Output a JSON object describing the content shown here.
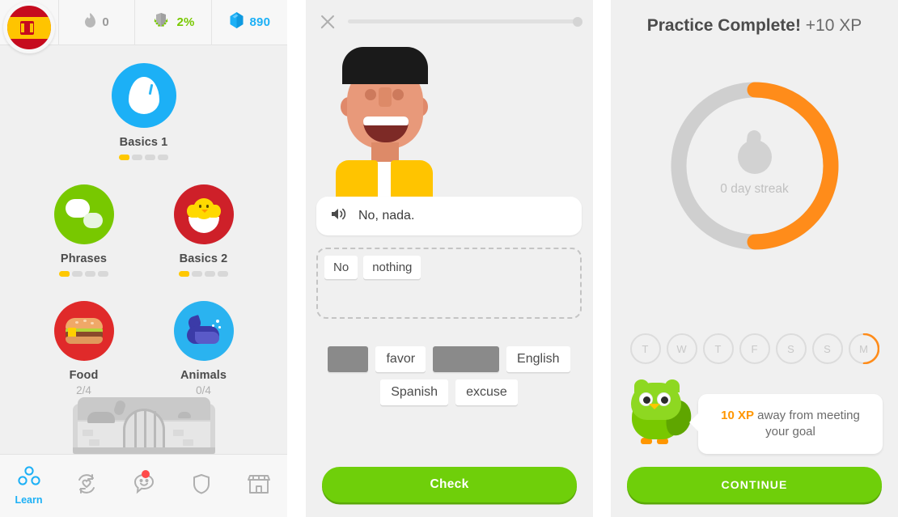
{
  "home": {
    "flag": {
      "name": "spanish-flag",
      "label": "Spanish"
    },
    "stats": [
      {
        "icon": "streak-flame-icon",
        "value": "0",
        "kind": "streak"
      },
      {
        "icon": "shield-laurel-icon",
        "value": "2%",
        "kind": "shield"
      },
      {
        "icon": "gem-icon",
        "value": "890",
        "kind": "gems"
      }
    ],
    "skills": [
      {
        "name": "Basics 1",
        "icon": "egg-icon",
        "color": "#1cb0f6",
        "fraction": "",
        "bars": 5,
        "filled": 1
      },
      {
        "name": "Phrases",
        "icon": "speech-bubbles-icon",
        "color": "#78c800",
        "fraction": "",
        "bars": 5,
        "filled": 1
      },
      {
        "name": "Basics 2",
        "icon": "chick-icon",
        "color": "#ce2029",
        "fraction": "",
        "bars": 5,
        "filled": 1
      },
      {
        "name": "Food",
        "icon": "burger-icon",
        "color": "#e02a2a",
        "fraction": "2/4",
        "bars": 0,
        "filled": 0
      },
      {
        "name": "Animals",
        "icon": "whale-icon",
        "color": "#2ab3f0",
        "fraction": "0/4",
        "bars": 0,
        "filled": 0
      }
    ],
    "checkpoint": {
      "name": "locked-checkpoint",
      "locked": true
    },
    "nav": [
      {
        "label": "Learn",
        "icon": "learn-dots-icon",
        "active": true,
        "badge": false
      },
      {
        "label": "",
        "icon": "practice-refresh-icon",
        "active": false,
        "badge": false
      },
      {
        "label": "",
        "icon": "chat-smiley-icon",
        "active": false,
        "badge": true
      },
      {
        "label": "",
        "icon": "shield-icon",
        "active": false,
        "badge": false
      },
      {
        "label": "",
        "icon": "shop-icon",
        "active": false,
        "badge": false
      }
    ]
  },
  "lesson": {
    "close_icon": "close-x-icon",
    "progress_percent": 0,
    "character": "illustration-man-yellow-jacket",
    "prompt": {
      "speaker_icon": "speaker-icon",
      "text": "No, nada."
    },
    "answer_tiles": [
      "No",
      "nothing"
    ],
    "word_bank": [
      {
        "text": "",
        "used": true
      },
      {
        "text": "favor",
        "used": false
      },
      {
        "text": "",
        "used": true
      },
      {
        "text": "English",
        "used": false
      },
      {
        "text": "Spanish",
        "used": false
      },
      {
        "text": "excuse",
        "used": false
      }
    ],
    "check_button": "Check"
  },
  "complete": {
    "title_bold": "Practice Complete!",
    "title_light": " +10 XP",
    "ring": {
      "label": "0 day streak",
      "percent": 50,
      "track_color": "#cfcfcf",
      "fill_color": "#ff8c1a",
      "flame_icon": "streak-flame-icon"
    },
    "days": [
      {
        "letter": "T",
        "progress": 0
      },
      {
        "letter": "W",
        "progress": 0
      },
      {
        "letter": "T",
        "progress": 0
      },
      {
        "letter": "F",
        "progress": 0
      },
      {
        "letter": "S",
        "progress": 0
      },
      {
        "letter": "S",
        "progress": 0
      },
      {
        "letter": "M",
        "progress": 30
      }
    ],
    "owl": "duo-owl-mascot",
    "bubble": {
      "highlight": "10 XP",
      "rest": " away from meeting your goal"
    },
    "continue_button": "CONTINUE"
  },
  "colors": {
    "green": "#6fcf0a",
    "blue": "#1cb0f6",
    "orange": "#ff8c1a",
    "gold": "#ffc800",
    "red": "#ce2029",
    "gray_text": "#4b4b4b"
  }
}
